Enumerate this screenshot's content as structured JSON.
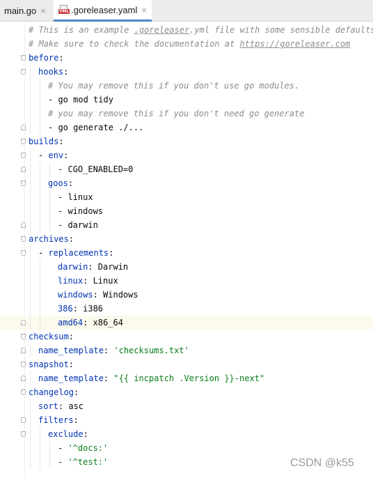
{
  "tabs": [
    {
      "label": "main.go",
      "close": "×",
      "active": false
    },
    {
      "label": ".goreleaser.yaml",
      "close": "×",
      "active": true
    }
  ],
  "file_icon": {
    "name": "yaml-file-icon",
    "text": "YML",
    "color": "#c7373c"
  },
  "colors": {
    "key": "#0033b3",
    "string": "#067d17",
    "comment": "#8c8c8c",
    "text": "#080808",
    "current_line": "#fcfaed",
    "active_tab_underline": "#4a88c7"
  },
  "current_line": 22,
  "lines": [
    {
      "indent": 0,
      "fold": "",
      "parts": [
        {
          "t": "c",
          "v": "# This is an example "
        },
        {
          "t": "u",
          "v": ".goreleaser"
        },
        {
          "t": "c",
          "v": ".yml file with some sensible defaults."
        }
      ]
    },
    {
      "indent": 0,
      "fold": "",
      "parts": [
        {
          "t": "c",
          "v": "# Make sure to check the documentation at "
        },
        {
          "t": "u",
          "v": "https://goreleaser.com"
        }
      ]
    },
    {
      "indent": 0,
      "fold": "open",
      "parts": [
        {
          "t": "k",
          "v": "before"
        },
        {
          "t": "t",
          "v": ":"
        }
      ]
    },
    {
      "indent": 1,
      "fold": "open",
      "parts": [
        {
          "t": "k",
          "v": "hooks"
        },
        {
          "t": "t",
          "v": ":"
        }
      ]
    },
    {
      "indent": 2,
      "fold": "",
      "parts": [
        {
          "t": "c",
          "v": "# You may remove this if you don't use go modules."
        }
      ]
    },
    {
      "indent": 2,
      "fold": "",
      "parts": [
        {
          "t": "t",
          "v": "- go mod tidy"
        }
      ]
    },
    {
      "indent": 2,
      "fold": "",
      "parts": [
        {
          "t": "c",
          "v": "# you may remove this if you don't need go generate"
        }
      ]
    },
    {
      "indent": 2,
      "fold": "close",
      "parts": [
        {
          "t": "t",
          "v": "- go generate ./..."
        }
      ]
    },
    {
      "indent": 0,
      "fold": "open",
      "parts": [
        {
          "t": "k",
          "v": "builds"
        },
        {
          "t": "t",
          "v": ":"
        }
      ]
    },
    {
      "indent": 1,
      "fold": "open",
      "parts": [
        {
          "t": "t",
          "v": "- "
        },
        {
          "t": "k",
          "v": "env"
        },
        {
          "t": "t",
          "v": ":"
        }
      ]
    },
    {
      "indent": 3,
      "fold": "close",
      "parts": [
        {
          "t": "t",
          "v": "- CGO_ENABLED=0"
        }
      ]
    },
    {
      "indent": 2,
      "fold": "open",
      "parts": [
        {
          "t": "k",
          "v": "goos"
        },
        {
          "t": "t",
          "v": ":"
        }
      ]
    },
    {
      "indent": 3,
      "fold": "",
      "parts": [
        {
          "t": "t",
          "v": "- linux"
        }
      ]
    },
    {
      "indent": 3,
      "fold": "",
      "parts": [
        {
          "t": "t",
          "v": "- windows"
        }
      ]
    },
    {
      "indent": 3,
      "fold": "close",
      "parts": [
        {
          "t": "t",
          "v": "- darwin"
        }
      ]
    },
    {
      "indent": 0,
      "fold": "open",
      "parts": [
        {
          "t": "k",
          "v": "archives"
        },
        {
          "t": "t",
          "v": ":"
        }
      ]
    },
    {
      "indent": 1,
      "fold": "open",
      "parts": [
        {
          "t": "t",
          "v": "- "
        },
        {
          "t": "k",
          "v": "replacements"
        },
        {
          "t": "t",
          "v": ":"
        }
      ]
    },
    {
      "indent": 3,
      "fold": "",
      "parts": [
        {
          "t": "k",
          "v": "darwin"
        },
        {
          "t": "t",
          "v": ": Darwin"
        }
      ]
    },
    {
      "indent": 3,
      "fold": "",
      "parts": [
        {
          "t": "k",
          "v": "linux"
        },
        {
          "t": "t",
          "v": ": Linux"
        }
      ]
    },
    {
      "indent": 3,
      "fold": "",
      "parts": [
        {
          "t": "k",
          "v": "windows"
        },
        {
          "t": "t",
          "v": ": Windows"
        }
      ]
    },
    {
      "indent": 3,
      "fold": "",
      "parts": [
        {
          "t": "k",
          "v": "386"
        },
        {
          "t": "t",
          "v": ": i386"
        }
      ]
    },
    {
      "indent": 3,
      "fold": "close",
      "parts": [
        {
          "t": "k",
          "v": "amd64"
        },
        {
          "t": "t",
          "v": ": x86_64"
        }
      ]
    },
    {
      "indent": 0,
      "fold": "open",
      "parts": [
        {
          "t": "k",
          "v": "checksum"
        },
        {
          "t": "t",
          "v": ":"
        }
      ]
    },
    {
      "indent": 1,
      "fold": "close",
      "parts": [
        {
          "t": "k",
          "v": "name_template"
        },
        {
          "t": "t",
          "v": ": "
        },
        {
          "t": "s",
          "v": "'checksums.txt'"
        }
      ]
    },
    {
      "indent": 0,
      "fold": "open",
      "parts": [
        {
          "t": "k",
          "v": "snapshot"
        },
        {
          "t": "t",
          "v": ":"
        }
      ]
    },
    {
      "indent": 1,
      "fold": "close",
      "parts": [
        {
          "t": "k",
          "v": "name_template"
        },
        {
          "t": "t",
          "v": ": "
        },
        {
          "t": "s",
          "v": "\"{{ incpatch .Version }}-next\""
        }
      ]
    },
    {
      "indent": 0,
      "fold": "open",
      "parts": [
        {
          "t": "k",
          "v": "changelog"
        },
        {
          "t": "t",
          "v": ":"
        }
      ]
    },
    {
      "indent": 1,
      "fold": "",
      "parts": [
        {
          "t": "k",
          "v": "sort"
        },
        {
          "t": "t",
          "v": ": asc"
        }
      ]
    },
    {
      "indent": 1,
      "fold": "open",
      "parts": [
        {
          "t": "k",
          "v": "filters"
        },
        {
          "t": "t",
          "v": ":"
        }
      ]
    },
    {
      "indent": 2,
      "fold": "open",
      "parts": [
        {
          "t": "k",
          "v": "exclude"
        },
        {
          "t": "t",
          "v": ":"
        }
      ]
    },
    {
      "indent": 3,
      "fold": "",
      "parts": [
        {
          "t": "t",
          "v": "- "
        },
        {
          "t": "s",
          "v": "'^docs:'"
        }
      ]
    },
    {
      "indent": 3,
      "fold": "",
      "parts": [
        {
          "t": "t",
          "v": "- "
        },
        {
          "t": "s",
          "v": "'^test:'"
        }
      ]
    }
  ],
  "watermark": "CSDN @k55"
}
